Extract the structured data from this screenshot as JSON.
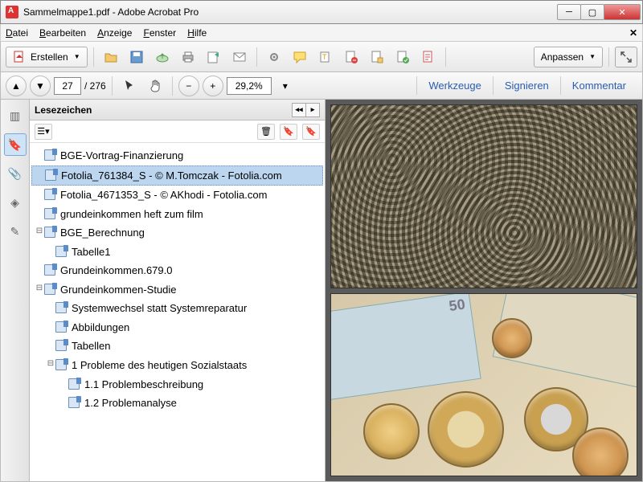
{
  "window": {
    "title": "Sammelmappe1.pdf - Adobe Acrobat Pro"
  },
  "menus": {
    "file": "Datei",
    "edit": "Bearbeiten",
    "view": "Anzeige",
    "window": "Fenster",
    "help": "Hilfe"
  },
  "toolbar": {
    "create": "Erstellen",
    "customize": "Anpassen"
  },
  "nav": {
    "page_current": "27",
    "page_total": "/ 276",
    "zoom": "29,2%"
  },
  "panels": {
    "tools": "Werkzeuge",
    "sign": "Signieren",
    "comment": "Kommentar"
  },
  "bookmarks": {
    "title": "Lesezeichen",
    "items": [
      {
        "label": "BGE-Vortrag-Finanzierung",
        "indent": 0,
        "twisty": "",
        "selected": false
      },
      {
        "label": "Fotolia_761384_S - © M.Tomczak - Fotolia.com",
        "indent": 0,
        "twisty": "",
        "selected": true
      },
      {
        "label": "Fotolia_4671353_S - © AKhodi - Fotolia.com",
        "indent": 0,
        "twisty": "",
        "selected": false
      },
      {
        "label": "grundeinkommen heft zum film",
        "indent": 0,
        "twisty": "",
        "selected": false
      },
      {
        "label": "BGE_Berechnung",
        "indent": 0,
        "twisty": "⊟",
        "selected": false
      },
      {
        "label": "Tabelle1",
        "indent": 1,
        "twisty": "",
        "selected": false
      },
      {
        "label": "Grundeinkommen.679.0",
        "indent": 0,
        "twisty": "",
        "selected": false
      },
      {
        "label": "Grundeinkommen-Studie",
        "indent": 0,
        "twisty": "⊟",
        "selected": false
      },
      {
        "label": "Systemwechsel statt Systemreparatur",
        "indent": 1,
        "twisty": "",
        "selected": false
      },
      {
        "label": "Abbildungen",
        "indent": 1,
        "twisty": "",
        "selected": false
      },
      {
        "label": "Tabellen",
        "indent": 1,
        "twisty": "",
        "selected": false
      },
      {
        "label": "1  Probleme des heutigen Sozialstaats",
        "indent": 1,
        "twisty": "⊟",
        "selected": false
      },
      {
        "label": "1.1 Problembeschreibung",
        "indent": 2,
        "twisty": "",
        "selected": false
      },
      {
        "label": "1.2 Problemanalyse",
        "indent": 2,
        "twisty": "",
        "selected": false
      }
    ]
  }
}
